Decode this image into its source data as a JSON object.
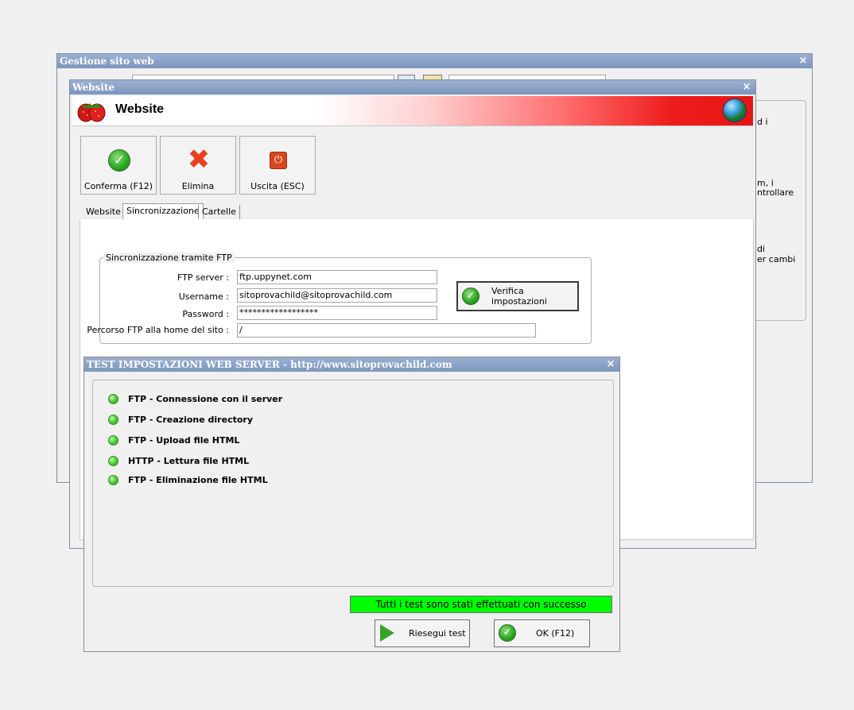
{
  "main_window": {
    "title": "Gestione sito web",
    "close": "×",
    "visible_text_fragments": [
      "d i",
      "m, i",
      "ntrollare",
      "di",
      "er cambi"
    ]
  },
  "website_window": {
    "title": "Website",
    "close": "×",
    "header_title": "Website",
    "toolbar": {
      "confirm_label": "Conferma (F12)",
      "delete_label": "Elimina",
      "exit_label": "Uscita (ESC)"
    },
    "tabs": [
      {
        "label": "Website",
        "active": false
      },
      {
        "label": "Sincronizzazione",
        "active": true
      },
      {
        "label": "Cartelle",
        "active": false
      }
    ],
    "ftp_group": {
      "legend": "Sincronizzazione tramite FTP",
      "server_label": "FTP server :",
      "server_value": "ftp.uppynet.com",
      "username_label": "Username :",
      "username_value": "sitoprovachild@sitoprovachild.com",
      "password_label": "Password :",
      "password_value": "******************",
      "path_label": "Percorso FTP alla home del sito :",
      "path_value": "/",
      "verify_button": "Verifica impostazioni"
    }
  },
  "test_window": {
    "title": "TEST IMPOSTAZIONI WEB SERVER - http://www.sitoprovachild.com",
    "close": "×",
    "tests": [
      {
        "label": "FTP - Connessione con il server",
        "status": "ok"
      },
      {
        "label": "FTP - Creazione directory",
        "status": "ok"
      },
      {
        "label": "FTP - Upload file HTML",
        "status": "ok"
      },
      {
        "label": "HTTP - Lettura file HTML",
        "status": "ok"
      },
      {
        "label": "FTP - Eliminazione file HTML",
        "status": "ok"
      }
    ],
    "status_message": "Tutti i test sono stati effettuati con successo",
    "rerun_button": "Riesegui test",
    "ok_button": "OK (F12)"
  },
  "colors": {
    "titlebar": "#8aa2c8",
    "success_status": "#00ff00",
    "header_gradient_end": "#e81414"
  },
  "icons": [
    "strawberry-icon",
    "globe-icon",
    "check-icon",
    "delete-x-icon",
    "power-icon",
    "led-green-icon",
    "play-icon"
  ]
}
